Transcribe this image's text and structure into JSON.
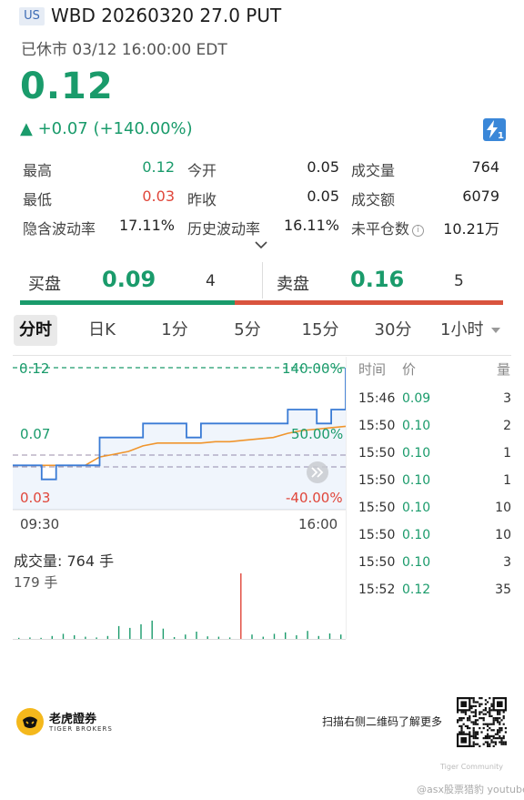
{
  "header": {
    "market_badge": "US",
    "title": "WBD 20260320 27.0 PUT",
    "status": "已休市 03/12 16:00:00 EDT"
  },
  "quote": {
    "price": "0.12",
    "change": "▲ +0.07 (+140.00%)",
    "flash_badge": "1"
  },
  "stats": {
    "high_label": "最高",
    "high_value": "0.12",
    "open_label": "今开",
    "open_value": "0.05",
    "volume_label": "成交量",
    "volume_value": "764",
    "low_label": "最低",
    "low_value": "0.03",
    "prev_close_label": "昨收",
    "prev_close_value": "0.05",
    "turnover_label": "成交额",
    "turnover_value": "6079",
    "iv_label": "隐含波动率",
    "iv_value": "17.11%",
    "hv_label": "历史波动率",
    "hv_value": "16.11%",
    "oi_label": "未平仓数",
    "oi_value": "10.21万"
  },
  "orderbook": {
    "bid_label": "买盘",
    "bid_price": "0.09",
    "bid_qty": "4",
    "ask_label": "卖盘",
    "ask_price": "0.16",
    "ask_qty": "5",
    "bid_share": 0.44
  },
  "tabs": [
    "分时",
    "日K",
    "1分",
    "5分",
    "15分",
    "30分",
    "1小时"
  ],
  "tab_dropdown_icon": "caret-down-icon",
  "chart": {
    "y_top_label": "0.12",
    "y_mid_label": "0.07",
    "y_bot_label": "0.03",
    "pct_top_label": "140.00%",
    "pct_mid_label": "50.00%",
    "pct_bot_label": "-40.00%",
    "time_start": "09:30",
    "time_end": "16:00",
    "volume_label": "成交量:  764 手",
    "volume_max_label": "179 手",
    "colors": {
      "price": "#3a7bd5",
      "avg": "#f0952d",
      "up": "#1a9b6b",
      "down": "#e0463a"
    }
  },
  "chart_data": {
    "type": "line",
    "title": "",
    "x": [
      "09:30",
      "16:00"
    ],
    "ylim": [
      0.03,
      0.12
    ],
    "prev_close": 0.05,
    "series": [
      {
        "values": [
          0.05,
          0.05,
          0.04,
          0.05,
          0.05,
          0.05,
          0.07,
          0.07,
          0.07,
          0.08,
          0.08,
          0.08,
          0.07,
          0.08,
          0.08,
          0.08,
          0.08,
          0.08,
          0.08,
          0.09,
          0.09,
          0.08,
          0.09,
          0.12
        ]
      },
      {
        "values": [
          0.05,
          0.05,
          0.05,
          0.05,
          0.05,
          0.05,
          0.056,
          0.058,
          0.06,
          0.064,
          0.066,
          0.066,
          0.066,
          0.066,
          0.067,
          0.067,
          0.068,
          0.069,
          0.07,
          0.073,
          0.075,
          0.076,
          0.077,
          0.078
        ]
      }
    ]
  },
  "volume_data": {
    "type": "bar",
    "max": 179,
    "values": [
      3,
      4,
      3,
      8,
      14,
      10,
      6,
      4,
      8,
      35,
      30,
      40,
      50,
      28,
      5,
      12,
      20,
      7,
      6,
      4,
      179,
      12,
      6,
      14,
      18,
      10,
      22,
      8,
      15,
      12
    ],
    "down_index": 20
  },
  "trades": {
    "header_time": "时间",
    "header_price": "价",
    "header_qty": "量",
    "rows": [
      {
        "time": "15:46",
        "price": "0.09",
        "qty": "3"
      },
      {
        "time": "15:50",
        "price": "0.10",
        "qty": "2"
      },
      {
        "time": "15:50",
        "price": "0.10",
        "qty": "1"
      },
      {
        "time": "15:50",
        "price": "0.10",
        "qty": "1"
      },
      {
        "time": "15:50",
        "price": "0.10",
        "qty": "10"
      },
      {
        "time": "15:50",
        "price": "0.10",
        "qty": "10"
      },
      {
        "time": "15:50",
        "price": "0.10",
        "qty": "3"
      },
      {
        "time": "15:52",
        "price": "0.12",
        "qty": "35"
      }
    ]
  },
  "footer": {
    "brand_cn": "老虎證券",
    "brand_en": "TIGER BROKERS",
    "promo": "扫描右侧二维码了解更多",
    "watermark_community": "Tiger Community",
    "watermark_channel": "@asx股票猎豹 youtube"
  }
}
